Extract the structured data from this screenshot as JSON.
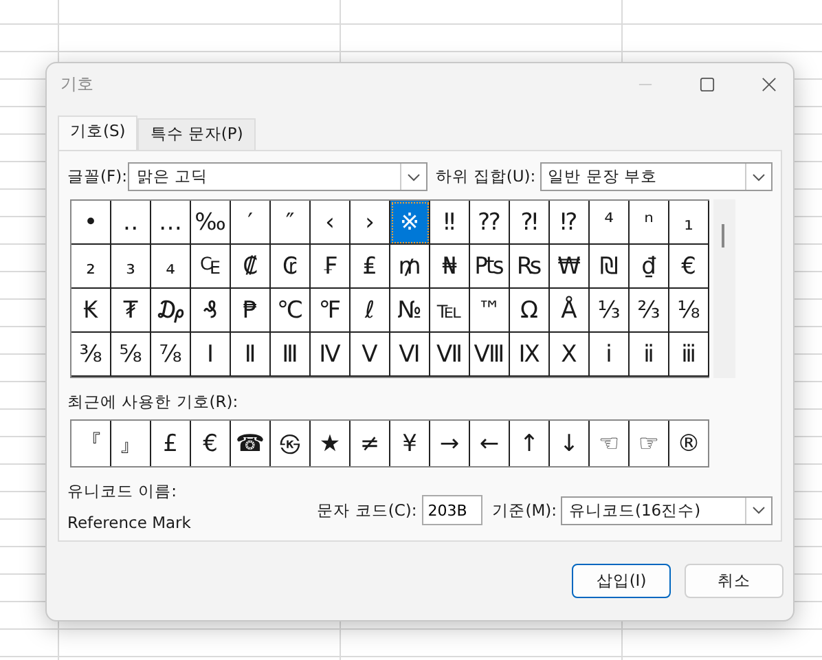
{
  "window": {
    "title": "기호"
  },
  "tabs": [
    {
      "label": "기호(S)",
      "selected": true
    },
    {
      "label": "특수 문자(P)",
      "selected": false
    }
  ],
  "font": {
    "label": "글꼴(F):",
    "value": "맑은 고딕"
  },
  "subset": {
    "label": "하위 집합(U):",
    "value": "일반 문장 부호"
  },
  "symbols": [
    {
      "char": "•",
      "selected": false
    },
    {
      "char": "‥",
      "selected": false
    },
    {
      "char": "…",
      "selected": false
    },
    {
      "char": "‰",
      "selected": false
    },
    {
      "char": "′",
      "selected": false
    },
    {
      "char": "″",
      "selected": false
    },
    {
      "char": "‹",
      "selected": false
    },
    {
      "char": "›",
      "selected": false
    },
    {
      "char": "※",
      "selected": true
    },
    {
      "char": "‼",
      "selected": false
    },
    {
      "char": "⁇",
      "selected": false
    },
    {
      "char": "⁈",
      "selected": false
    },
    {
      "char": "⁉",
      "selected": false
    },
    {
      "char": "⁴",
      "selected": false
    },
    {
      "char": "ⁿ",
      "selected": false
    },
    {
      "char": "₁",
      "selected": false
    },
    {
      "char": "₂",
      "selected": false
    },
    {
      "char": "₃",
      "selected": false
    },
    {
      "char": "₄",
      "selected": false
    },
    {
      "char": "₠",
      "selected": false
    },
    {
      "char": "₡",
      "selected": false
    },
    {
      "char": "₢",
      "selected": false
    },
    {
      "char": "₣",
      "selected": false
    },
    {
      "char": "₤",
      "selected": false
    },
    {
      "char": "₥",
      "selected": false
    },
    {
      "char": "₦",
      "selected": false
    },
    {
      "char": "₧",
      "selected": false
    },
    {
      "char": "₨",
      "selected": false
    },
    {
      "char": "₩",
      "selected": false
    },
    {
      "char": "₪",
      "selected": false
    },
    {
      "char": "₫",
      "selected": false
    },
    {
      "char": "€",
      "selected": false
    },
    {
      "char": "₭",
      "selected": false
    },
    {
      "char": "₮",
      "selected": false
    },
    {
      "char": "₯",
      "selected": false
    },
    {
      "char": "₰",
      "selected": false
    },
    {
      "char": "₱",
      "selected": false
    },
    {
      "char": "℃",
      "selected": false
    },
    {
      "char": "℉",
      "selected": false
    },
    {
      "char": "ℓ",
      "selected": false
    },
    {
      "char": "№",
      "selected": false
    },
    {
      "char": "℡",
      "selected": false
    },
    {
      "char": "™",
      "selected": false
    },
    {
      "char": "Ω",
      "selected": false
    },
    {
      "char": "Å",
      "selected": false
    },
    {
      "char": "⅓",
      "selected": false
    },
    {
      "char": "⅔",
      "selected": false
    },
    {
      "char": "⅛",
      "selected": false
    },
    {
      "char": "⅜",
      "selected": false
    },
    {
      "char": "⅝",
      "selected": false
    },
    {
      "char": "⅞",
      "selected": false
    },
    {
      "char": "Ⅰ",
      "selected": false
    },
    {
      "char": "Ⅱ",
      "selected": false
    },
    {
      "char": "Ⅲ",
      "selected": false
    },
    {
      "char": "Ⅳ",
      "selected": false
    },
    {
      "char": "Ⅴ",
      "selected": false
    },
    {
      "char": "Ⅵ",
      "selected": false
    },
    {
      "char": "Ⅶ",
      "selected": false
    },
    {
      "char": "Ⅷ",
      "selected": false
    },
    {
      "char": "Ⅸ",
      "selected": false
    },
    {
      "char": "Ⅹ",
      "selected": false
    },
    {
      "char": "ⅰ",
      "selected": false
    },
    {
      "char": "ⅱ",
      "selected": false
    },
    {
      "char": "ⅲ",
      "selected": false
    }
  ],
  "recent": {
    "label": "최근에 사용한 기호(R):",
    "symbols": [
      "『",
      "』",
      "£",
      "€",
      "☎",
      "㉿",
      "★",
      "≠",
      "¥",
      "→",
      "←",
      "↑",
      "↓",
      "☜",
      "☞",
      "®"
    ]
  },
  "unicode_name": {
    "label": "유니코드 이름:",
    "value": "Reference Mark"
  },
  "char_code": {
    "label": "문자 코드(C):",
    "value": "203B"
  },
  "from": {
    "label": "기준(M):",
    "value": "유니코드(16진수)"
  },
  "buttons": [
    {
      "label": "삽입(I)",
      "kind": "primary"
    },
    {
      "label": "취소",
      "kind": "secondary"
    }
  ]
}
